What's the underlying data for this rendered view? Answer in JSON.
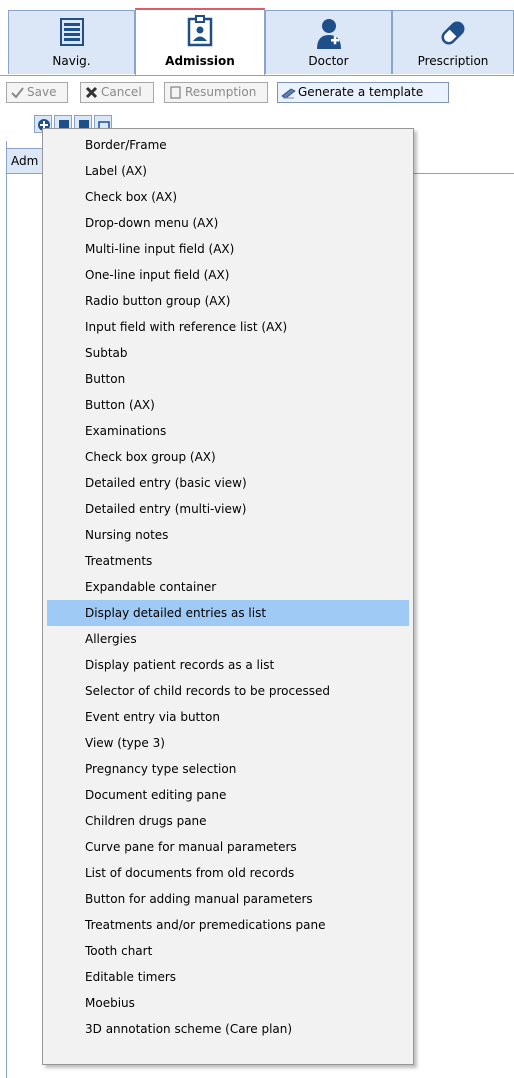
{
  "tabs": [
    {
      "label": "Navig.",
      "icon": "menu-list-icon"
    },
    {
      "label": "Admission",
      "icon": "id-badge-icon",
      "active": true
    },
    {
      "label": "Doctor",
      "icon": "doctor-icon"
    },
    {
      "label": "Prescription",
      "icon": "pill-icon"
    }
  ],
  "toolbar": {
    "save": "Save",
    "cancel": "Cancel",
    "resumption": "Resumption",
    "generate": "Generate a template"
  },
  "subtab": {
    "label": "Adm"
  },
  "menu": {
    "items": [
      "Border/Frame",
      "Label (AX)",
      "Check box (AX)",
      "Drop-down menu (AX)",
      "Multi-line input field (AX)",
      "One-line input field (AX)",
      "Radio button group (AX)",
      "Input field with reference list (AX)",
      "Subtab",
      "Button",
      "Button (AX)",
      "Examinations",
      "Check box group (AX)",
      "Detailed entry (basic view)",
      "Detailed entry (multi-view)",
      "Nursing notes",
      "Treatments",
      "Expandable container",
      "Display detailed entries as list",
      "Allergies",
      "Display patient records as a list",
      "Selector of child records to be processed",
      "Event entry via button",
      "View (type 3)",
      "Pregnancy type selection",
      "Document editing pane",
      "Children drugs pane",
      "Curve pane for manual parameters",
      "List of documents from old records",
      "Button for adding manual parameters",
      "Treatments and/or premedications pane",
      "Tooth chart",
      "Editable timers",
      "Moebius",
      "3D annotation scheme (Care plan)"
    ],
    "highlighted_index": 18
  },
  "colors": {
    "accent": "#9fcaf5",
    "tab_bg": "#dbe6f7",
    "icon_blue": "#1f4f8a"
  }
}
